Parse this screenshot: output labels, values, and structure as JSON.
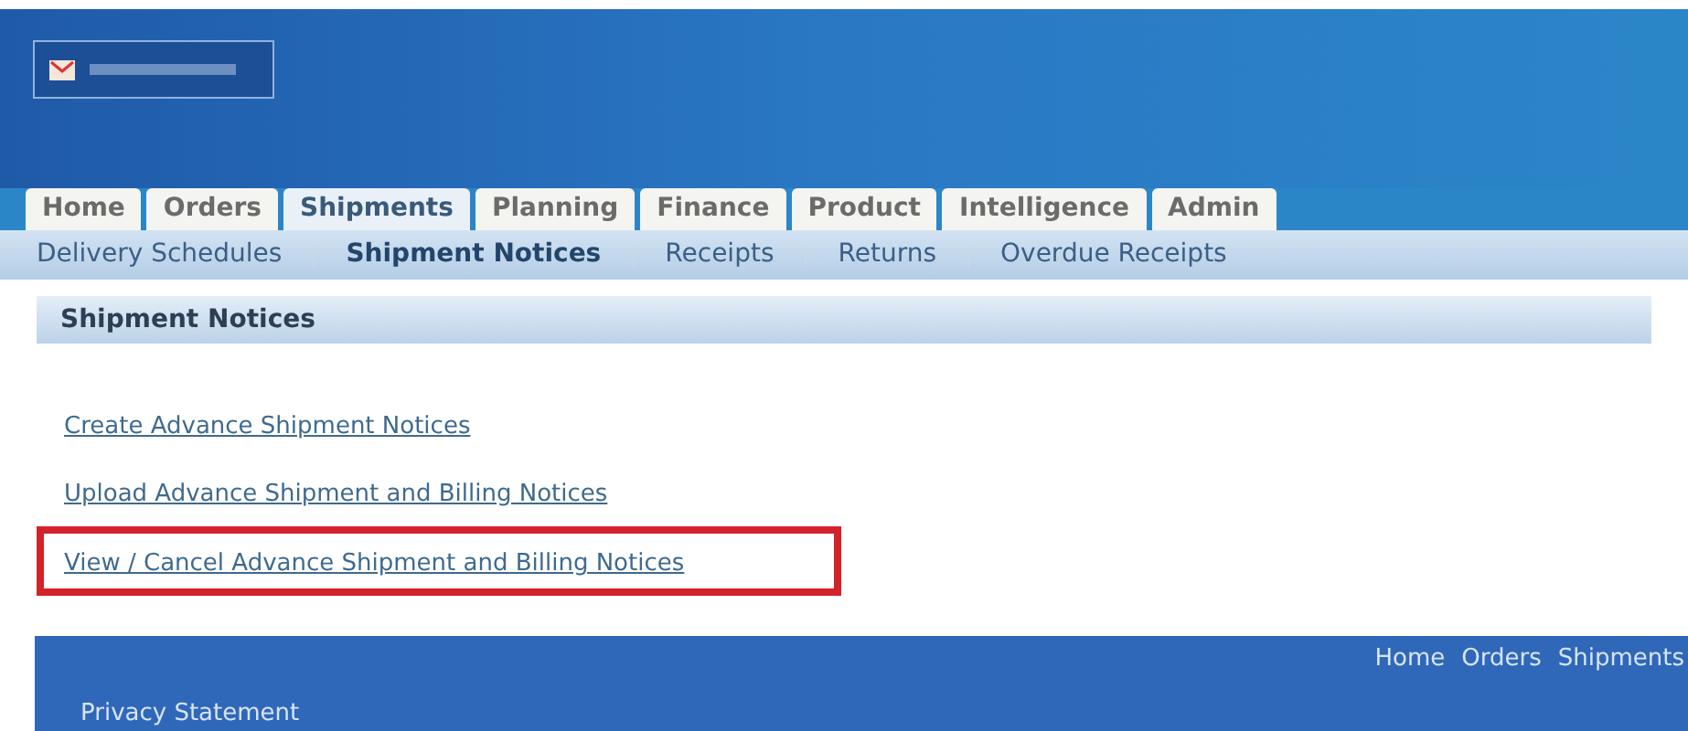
{
  "tabs": [
    {
      "label": "Home",
      "selected": false
    },
    {
      "label": "Orders",
      "selected": false
    },
    {
      "label": "Shipments",
      "selected": true
    },
    {
      "label": "Planning",
      "selected": false
    },
    {
      "label": "Finance",
      "selected": false
    },
    {
      "label": "Product",
      "selected": false
    },
    {
      "label": "Intelligence",
      "selected": false
    },
    {
      "label": "Admin",
      "selected": false
    }
  ],
  "subtabs": [
    {
      "label": "Delivery Schedules",
      "selected": false
    },
    {
      "label": "Shipment Notices",
      "selected": true
    },
    {
      "label": "Receipts",
      "selected": false
    },
    {
      "label": "Returns",
      "selected": false
    },
    {
      "label": "Overdue Receipts",
      "selected": false
    }
  ],
  "section_title": "Shipment Notices",
  "links": [
    {
      "label": "Create Advance Shipment Notices",
      "highlighted": false
    },
    {
      "label": "Upload Advance Shipment and Billing Notices",
      "highlighted": false
    },
    {
      "label": "View / Cancel Advance Shipment and Billing Notices",
      "highlighted": true
    }
  ],
  "footer": {
    "links": [
      "Home",
      "Orders",
      "Shipments"
    ],
    "privacy": "Privacy Statement"
  }
}
